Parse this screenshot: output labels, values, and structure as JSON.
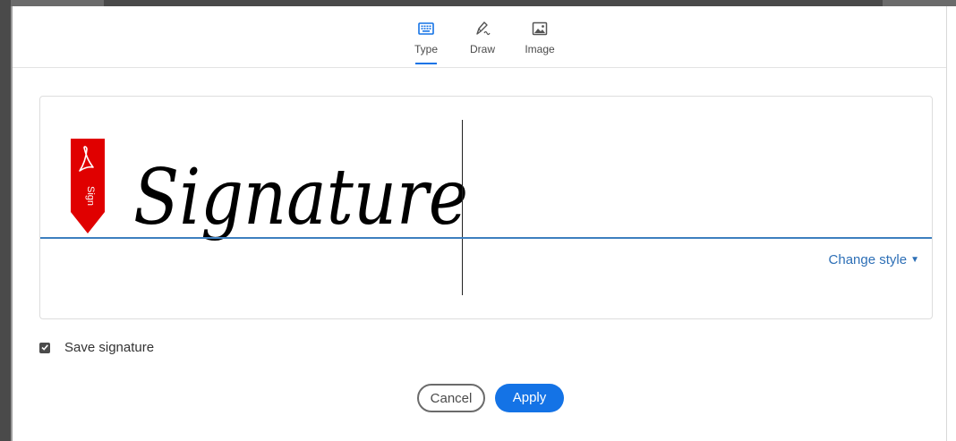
{
  "tabs": [
    {
      "label": "Type",
      "icon": "keyboard-icon",
      "active": true
    },
    {
      "label": "Draw",
      "icon": "pen-draw-icon",
      "active": false
    },
    {
      "label": "Image",
      "icon": "image-icon",
      "active": false
    }
  ],
  "signature": {
    "typed_text": "Signature",
    "flag_label": "Sign",
    "flag_icon": "acrobat-icon",
    "change_style_label": "Change style",
    "change_style_icon": "caret-down-icon"
  },
  "save_signature": {
    "label": "Save signature",
    "checked": true
  },
  "buttons": {
    "cancel_label": "Cancel",
    "apply_label": "Apply"
  },
  "colors": {
    "accent": "#1473e6",
    "flag_red": "#e00000",
    "baseline_blue": "#3d7fbf",
    "link_blue": "#2d6fb6"
  }
}
